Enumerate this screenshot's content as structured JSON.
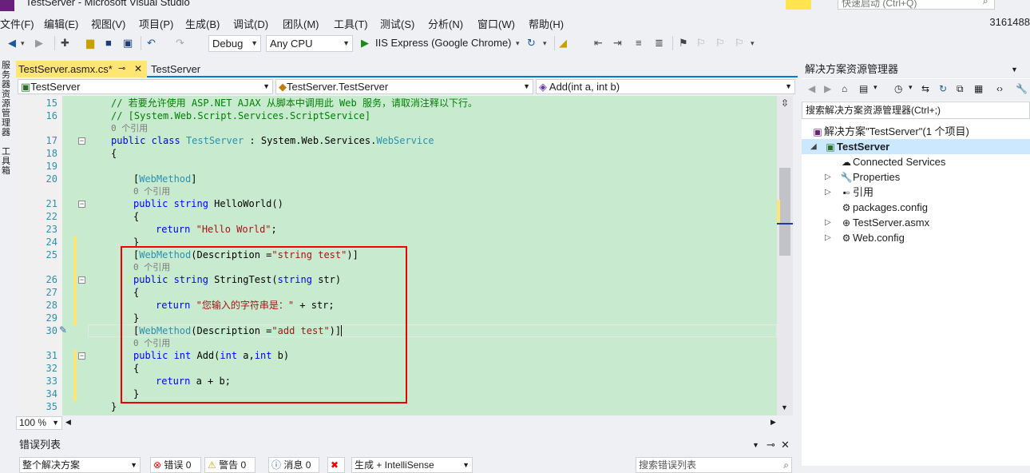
{
  "window": {
    "title": "TestServer - Microsoft Visual Studio",
    "quick_launch": "快速启动 (Ctrl+Q)",
    "user_id": "3161488"
  },
  "menu": [
    "文件(F)",
    "编辑(E)",
    "视图(V)",
    "项目(P)",
    "生成(B)",
    "调试(D)",
    "团队(M)",
    "工具(T)",
    "测试(S)",
    "分析(N)",
    "窗口(W)",
    "帮助(H)"
  ],
  "toolbar": {
    "config": "Debug",
    "platform": "Any CPU",
    "run_target": "IIS Express (Google Chrome)"
  },
  "left_strip": {
    "server_explorer": "服务器资源管理器",
    "toolbox": "工具箱"
  },
  "tabs": {
    "active": "TestServer.asmx.cs*",
    "second": "TestServer"
  },
  "nav": {
    "project": "TestServer",
    "class": "TestServer.TestServer",
    "member": "Add(int a, int b)"
  },
  "code": {
    "l15_num": "15",
    "l15": "// 若要允许使用 ASP.NET AJAX 从脚本中调用此 Web 服务，请取消注释以下行。",
    "l16_num": "16",
    "l16": "// [System.Web.Script.Services.ScriptService]",
    "ref0": "0 个引用",
    "l17_num": "17",
    "l17_kw": "public class",
    "l17_name": "TestServer",
    "l17_colon": " : System.Web.Services.",
    "l17_base": "WebService",
    "l18_num": "18",
    "l18": "{",
    "l19_num": "19",
    "l20_num": "20",
    "l20_open": "[",
    "l20_attr": "WebMethod",
    "l20_close": "]",
    "l21_num": "21",
    "l21_kw": "public string",
    "l21_rest": " HelloWorld()",
    "l22_num": "22",
    "l22": "{",
    "l23_num": "23",
    "l23_kw": "return",
    "l23_str": "\"Hello World\"",
    "l23_end": ";",
    "l24_num": "24",
    "l24": "}",
    "l25_num": "25",
    "l25_open": "[",
    "l25_attr": "WebMethod",
    "l25_mid": "(Description =",
    "l25_str": "\"string test\"",
    "l25_close": ")]",
    "l26_num": "26",
    "l26_kw": "public string",
    "l26_mid": " StringTest(",
    "l26_kw2": "string",
    "l26_end": " str)",
    "l27_num": "27",
    "l27": "{",
    "l28_num": "28",
    "l28_kw": "return",
    "l28_str": "\"您输入的字符串是：\"",
    "l28_end": " + str;",
    "l29_num": "29",
    "l29": "}",
    "l30_num": "30",
    "l30_open": "[",
    "l30_attr": "WebMethod",
    "l30_mid": "(Description =",
    "l30_str": "\"add test\"",
    "l30_close": ")]",
    "l31_num": "31",
    "l31_kw": "public int",
    "l31_mid": " Add(",
    "l31_kw2": "int",
    "l31_a": " a,",
    "l31_kw3": "int",
    "l31_end": " b)",
    "l32_num": "32",
    "l32": "{",
    "l33_num": "33",
    "l33_kw": "return",
    "l33_end": " a + b;",
    "l34_num": "34",
    "l34": "}",
    "l35_num": "35",
    "l35": "}"
  },
  "zoom": "100 %",
  "error_list": {
    "title": "错误列表",
    "scope": "整个解决方案",
    "errors": "错误 0",
    "warnings": "警告 0",
    "messages": "消息 0",
    "filter": "生成 + IntelliSense",
    "search": "搜索错误列表"
  },
  "solution_explorer": {
    "title": "解决方案资源管理器",
    "search": "搜索解决方案资源管理器(Ctrl+;)",
    "solution": "解决方案\"TestServer\"(1 个项目)",
    "project": "TestServer",
    "items": [
      "Connected Services",
      "Properties",
      "引用",
      "packages.config",
      "TestServer.asmx",
      "Web.config"
    ]
  }
}
